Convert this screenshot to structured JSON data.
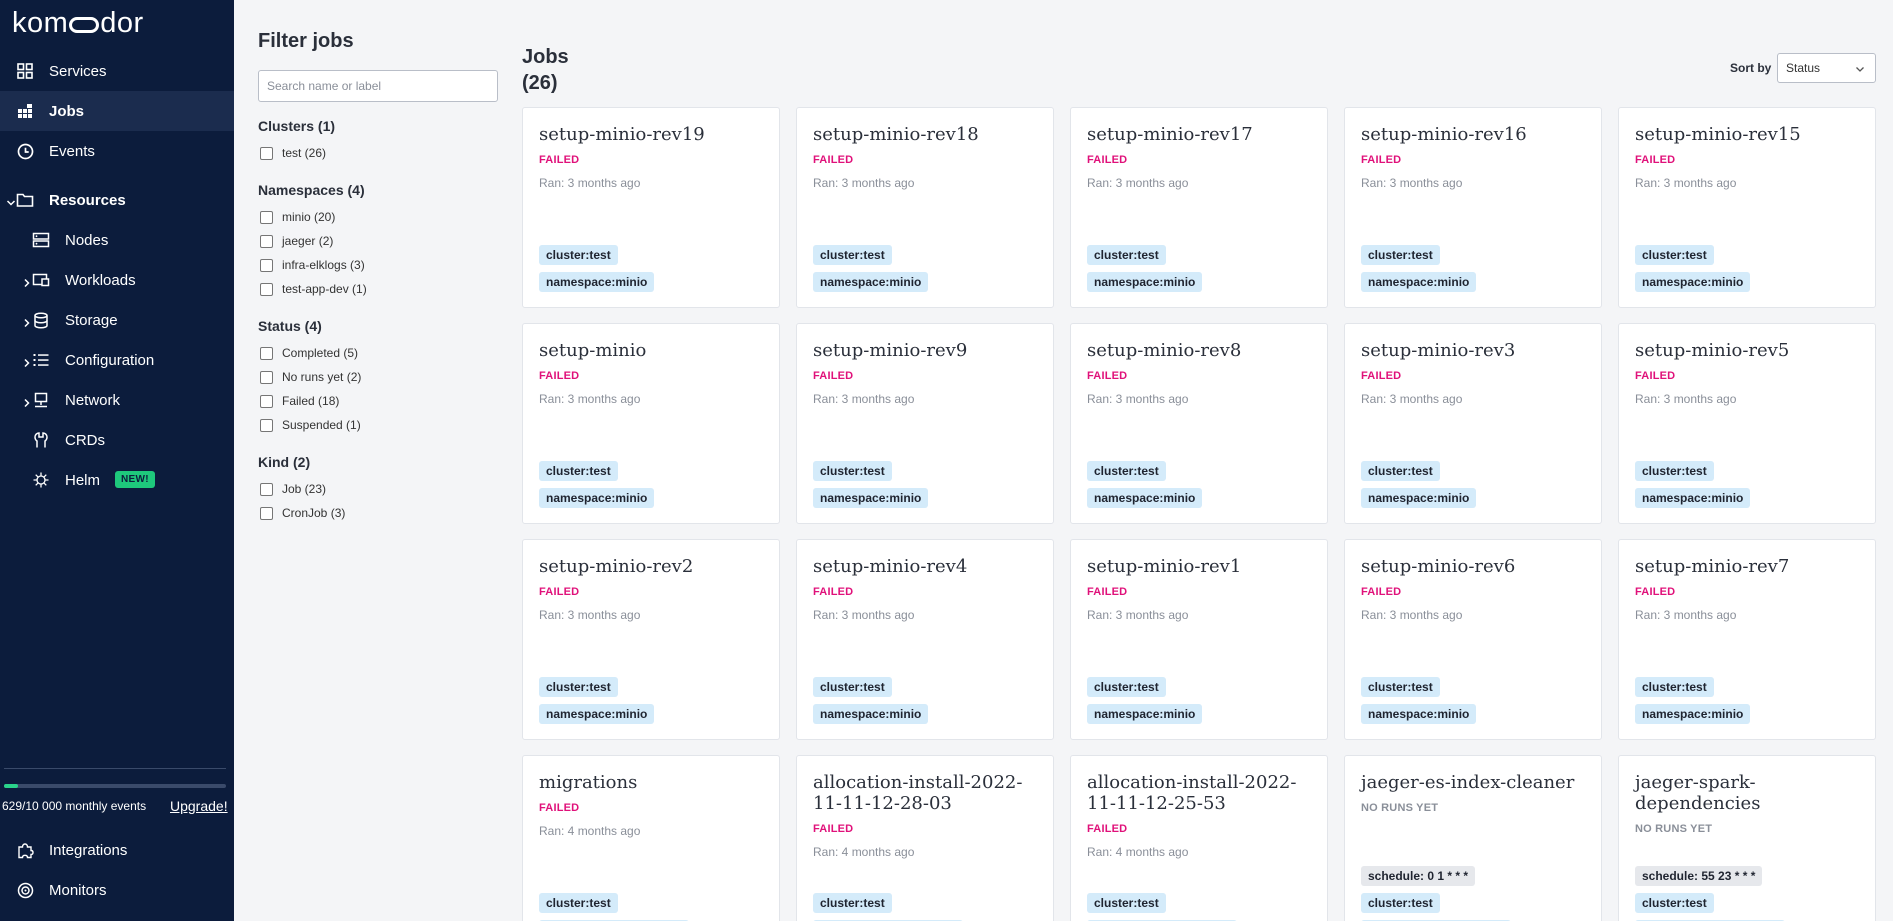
{
  "app": {
    "logo_prefix": "kom",
    "logo_suffix": "dor"
  },
  "sidebar": {
    "items": [
      {
        "label": "Services",
        "icon": "grid-icon"
      },
      {
        "label": "Jobs",
        "icon": "jobs-icon"
      },
      {
        "label": "Events",
        "icon": "clock-icon"
      },
      {
        "label": "Resources",
        "icon": "folder-icon"
      },
      {
        "label": "Nodes",
        "icon": "server-icon"
      },
      {
        "label": "Workloads",
        "icon": "workloads-icon"
      },
      {
        "label": "Storage",
        "icon": "database-icon"
      },
      {
        "label": "Configuration",
        "icon": "list-icon"
      },
      {
        "label": "Network",
        "icon": "network-icon"
      },
      {
        "label": "CRDs",
        "icon": "crd-icon"
      },
      {
        "label": "Helm",
        "icon": "helm-icon",
        "badge": "NEW!"
      }
    ],
    "usage": {
      "text": "629/10 000 monthly events",
      "fraction": 0.063,
      "upgrade_label": "Upgrade!"
    },
    "bottom_items": [
      {
        "label": "Integrations",
        "icon": "puzzle-icon"
      },
      {
        "label": "Monitors",
        "icon": "target-icon"
      }
    ],
    "accent": "#2ad38b"
  },
  "filters": {
    "title": "Filter jobs",
    "search_placeholder": "Search name or label",
    "groups": [
      {
        "title": "Clusters (1)",
        "options": [
          "test (26)"
        ]
      },
      {
        "title": "Namespaces (4)",
        "options": [
          "minio (20)",
          "jaeger (2)",
          "infra-elklogs (3)",
          "test-app-dev (1)"
        ]
      },
      {
        "title": "Status (4)",
        "options": [
          "Completed (5)",
          "No runs yet (2)",
          "Failed (18)",
          "Suspended (1)"
        ]
      },
      {
        "title": "Kind (2)",
        "options": [
          "Job (23)",
          "CronJob (3)"
        ]
      }
    ]
  },
  "jobs": {
    "title_line1": "Jobs",
    "title_line2": "(26)",
    "sort_label": "Sort by",
    "sort_value": "Status",
    "cards": [
      {
        "name": "setup-minio-rev19",
        "status": "FAILED",
        "ran": "Ran: 3 months ago",
        "tags": [
          "cluster:test",
          "namespace:minio"
        ]
      },
      {
        "name": "setup-minio-rev18",
        "status": "FAILED",
        "ran": "Ran: 3 months ago",
        "tags": [
          "cluster:test",
          "namespace:minio"
        ]
      },
      {
        "name": "setup-minio-rev17",
        "status": "FAILED",
        "ran": "Ran: 3 months ago",
        "tags": [
          "cluster:test",
          "namespace:minio"
        ]
      },
      {
        "name": "setup-minio-rev16",
        "status": "FAILED",
        "ran": "Ran: 3 months ago",
        "tags": [
          "cluster:test",
          "namespace:minio"
        ]
      },
      {
        "name": "setup-minio-rev15",
        "status": "FAILED",
        "ran": "Ran: 3 months ago",
        "tags": [
          "cluster:test",
          "namespace:minio"
        ]
      },
      {
        "name": "setup-minio",
        "status": "FAILED",
        "ran": "Ran: 3 months ago",
        "tags": [
          "cluster:test",
          "namespace:minio"
        ]
      },
      {
        "name": "setup-minio-rev9",
        "status": "FAILED",
        "ran": "Ran: 3 months ago",
        "tags": [
          "cluster:test",
          "namespace:minio"
        ]
      },
      {
        "name": "setup-minio-rev8",
        "status": "FAILED",
        "ran": "Ran: 3 months ago",
        "tags": [
          "cluster:test",
          "namespace:minio"
        ]
      },
      {
        "name": "setup-minio-rev3",
        "status": "FAILED",
        "ran": "Ran: 3 months ago",
        "tags": [
          "cluster:test",
          "namespace:minio"
        ]
      },
      {
        "name": "setup-minio-rev5",
        "status": "FAILED",
        "ran": "Ran: 3 months ago",
        "tags": [
          "cluster:test",
          "namespace:minio"
        ]
      },
      {
        "name": "setup-minio-rev2",
        "status": "FAILED",
        "ran": "Ran: 3 months ago",
        "tags": [
          "cluster:test",
          "namespace:minio"
        ]
      },
      {
        "name": "setup-minio-rev4",
        "status": "FAILED",
        "ran": "Ran: 3 months ago",
        "tags": [
          "cluster:test",
          "namespace:minio"
        ]
      },
      {
        "name": "setup-minio-rev1",
        "status": "FAILED",
        "ran": "Ran: 3 months ago",
        "tags": [
          "cluster:test",
          "namespace:minio"
        ]
      },
      {
        "name": "setup-minio-rev6",
        "status": "FAILED",
        "ran": "Ran: 3 months ago",
        "tags": [
          "cluster:test",
          "namespace:minio"
        ]
      },
      {
        "name": "setup-minio-rev7",
        "status": "FAILED",
        "ran": "Ran: 3 months ago",
        "tags": [
          "cluster:test",
          "namespace:minio"
        ]
      },
      {
        "name": "migrations",
        "status": "FAILED",
        "ran": "Ran: 4 months ago",
        "tags": [
          "cluster:test",
          ""
        ]
      },
      {
        "name": "allocation-install-2022-11-11-12-28-03",
        "status": "FAILED",
        "ran": "Ran: 4 months ago",
        "tags": [
          "cluster:test",
          ""
        ]
      },
      {
        "name": "allocation-install-2022-11-11-12-25-53",
        "status": "FAILED",
        "ran": "Ran: 4 months ago",
        "tags": [
          "cluster:test",
          ""
        ]
      },
      {
        "name": "jaeger-es-index-cleaner",
        "status": "NO RUNS YET",
        "ran": "",
        "schedule": "schedule: 0 1 * * *",
        "tags": [
          "cluster:test",
          ""
        ]
      },
      {
        "name": "jaeger-spark-dependencies",
        "status": "NO RUNS YET",
        "ran": "",
        "schedule": "schedule: 55 23 * * *",
        "tags": [
          "cluster:test",
          ""
        ]
      }
    ],
    "colors": {
      "failed": "#e0117a",
      "no_runs": "#8a8f99",
      "tag_bg": "#d4ebfa"
    }
  }
}
